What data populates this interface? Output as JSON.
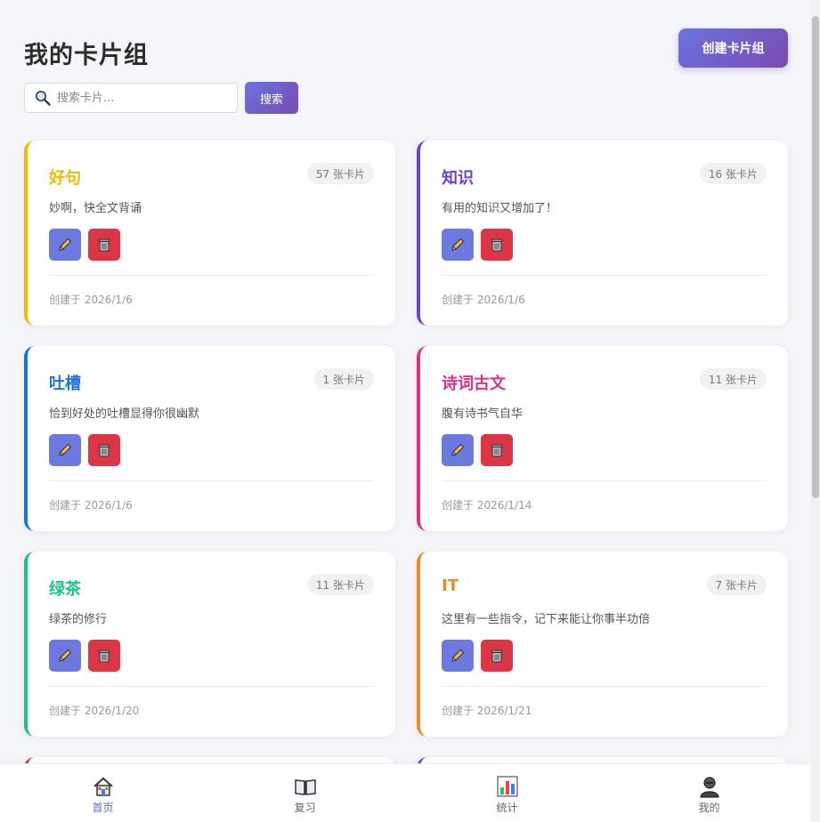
{
  "header": {
    "title": "我的卡片组",
    "create_label": "创建卡片组"
  },
  "search": {
    "placeholder": "搜索卡片...",
    "button_label": "搜索"
  },
  "decks": [
    {
      "title": "好句",
      "count": "57 张卡片",
      "description": "妙啊，快全文背诵",
      "date": "创建于 2026/1/6",
      "color": "#f5b800"
    },
    {
      "title": "知识",
      "count": "16 张卡片",
      "description": "有用的知识又增加了！",
      "date": "创建于 2026/1/6",
      "color": "#6f42c1"
    },
    {
      "title": "吐槽",
      "count": "1 张卡片",
      "description": "恰到好处的吐槽显得你很幽默",
      "date": "创建于 2026/1/6",
      "color": "#1a73d9"
    },
    {
      "title": "诗词古文",
      "count": "11 张卡片",
      "description": "腹有诗书气自华",
      "date": "创建于 2026/1/14",
      "color": "#d63384"
    },
    {
      "title": "绿茶",
      "count": "11 张卡片",
      "description": "绿茶的修行",
      "date": "创建于 2026/1/20",
      "color": "#20c08a"
    },
    {
      "title": "IT",
      "count": "7 张卡片",
      "description": "这里有一些指令，记下来能让你事半功倍",
      "date": "创建于 2026/1/21",
      "color": "#f08a24"
    }
  ],
  "peek_colors": [
    "#dc3545",
    "#6f42c1"
  ],
  "tabs": [
    {
      "label": "首页",
      "icon": "house-icon",
      "active": true
    },
    {
      "label": "复习",
      "icon": "book-icon",
      "active": false
    },
    {
      "label": "统计",
      "icon": "bar-chart-icon",
      "active": false
    },
    {
      "label": "我的",
      "icon": "person-icon",
      "active": false
    }
  ],
  "colors": {
    "accent_start": "#6a73e0",
    "accent_end": "#7b4bb0",
    "edit": "#6c7ae0",
    "delete": "#dc3545"
  }
}
